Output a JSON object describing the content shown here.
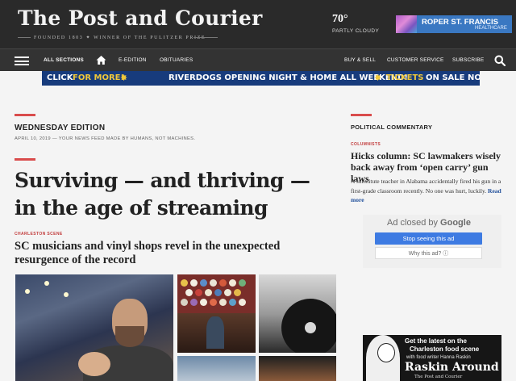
{
  "masthead": {
    "logo": "The Post and Courier",
    "tagline": "FOUNDED 1803 ✦ WINNER OF THE PULITZER PRIZE",
    "weather_temp": "70°",
    "weather_desc": "PARTLY CLOUDY",
    "ad_line1": "ROPER ST. FRANCIS",
    "ad_line2": "HEALTHCARE"
  },
  "nav": {
    "all_sections": "ALL SECTIONS",
    "e_edition": "E-EDITION",
    "obituaries": "OBITUARIES",
    "buy_sell": "BUY & SELL",
    "customer_service": "CUSTOMER SERVICE",
    "subscribe": "SUBSCRIBE"
  },
  "promo": {
    "part1": "CLICK",
    "part2": "FOR MORE!",
    "part3": "RIVERDOGS OPENING NIGHT & HOME ALL WEEKEND!",
    "part4": "TICKETS",
    "part5": "ON SALE NOW!"
  },
  "main": {
    "edition_title": "WEDNESDAY EDITION",
    "edition_date": "APRIL 10, 2019 — YOUR NEWS FEED MADE BY HUMANS, NOT MACHINES.",
    "headline": "Surviving — and thriving — in the age of streaming",
    "kicker": "CHARLESTON SCENE",
    "subhead": "SC musicians and vinyl shops revel in the unexpected resurgence of the record"
  },
  "sidebar": {
    "section_title": "POLITICAL COMMENTARY",
    "kicker": "COLUMNISTS",
    "headline": "Hicks column: SC lawmakers wisely back away from ‘open carry’ gun laws",
    "body": "A substitute teacher in Alabama accidentally fired his gun in a first-grade classroom recently. No one was hurt, luckily.",
    "read_more": "Read more"
  },
  "ad_closed": {
    "label": "Ad closed by",
    "brand": "Google",
    "stop_button": "Stop seeing this ad",
    "why_button": "Why this ad? ⓘ"
  },
  "ad_bottom": {
    "line1": "Get the latest on the",
    "line2": "Charleston food scene",
    "line3": "with food writer Hanna Raskin",
    "line4": "Raskin Around",
    "line5": "The Post and Courier"
  },
  "colors": {
    "masthead_bg": "#2a2a2a",
    "accent_red": "#d94c4c",
    "promo_bg": "#173b7c",
    "promo_yellow": "#f0c83a",
    "google_blue": "#3e7be2"
  }
}
